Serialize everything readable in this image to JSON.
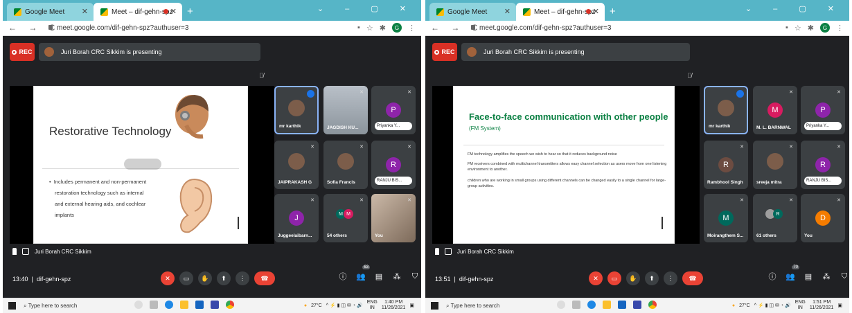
{
  "panes": [
    {
      "tabs": [
        "Google Meet",
        "Meet – dif-gehn-spz"
      ],
      "url": "meet.google.com/dif-gehn-spz?authuser=3",
      "rec_label": "REC",
      "presenting": "Juri Borah CRC Sikkim is presenting",
      "slide": {
        "title": "Restorative Technology",
        "bullets": [
          "Includes permanent and non-permanent restoration technology such as internal and external hearing aids, and cochlear implants"
        ]
      },
      "tiles": [
        {
          "name": "mr karthik",
          "kind": "photo",
          "selected": true
        },
        {
          "name": "JAGDISH KU...",
          "kind": "photo"
        },
        {
          "name": "Priyanka Y...",
          "letter": "P",
          "color": "#8e24aa",
          "pill": true
        },
        {
          "name": "JAIPRAKASH G",
          "kind": "photo"
        },
        {
          "name": "Sofia Francis",
          "kind": "photo"
        },
        {
          "name": "RANJU BIS...",
          "letter": "R",
          "color": "#8e24aa",
          "pill": true
        },
        {
          "name": "Juggeelaibarn...",
          "letter": "J",
          "color": "#8e24aa"
        },
        {
          "name": "54 others",
          "group": [
            "M",
            "M"
          ]
        },
        {
          "name": "You",
          "kind": "video"
        }
      ],
      "presenter_bar": "Juri Borah CRC Sikkim",
      "time": "13:40",
      "meeting_code": "dif-gehn-spz",
      "people_count": "63",
      "taskbar": {
        "search": "Type here to search",
        "temp": "27°C",
        "lang": "ENG",
        "region": "IN",
        "clock": "1:40 PM",
        "date": "11/26/2021"
      }
    },
    {
      "tabs": [
        "Google Meet",
        "Meet – dif-gehn-spz"
      ],
      "url": "meet.google.com/dif-gehn-spz?authuser=3",
      "rec_label": "REC",
      "presenting": "Juri Borah CRC Sikkim is presenting",
      "slide": {
        "title": "Face-to-face communication with other people",
        "subtitle": "(FM System)",
        "paragraphs": [
          "FM technology amplifies the speech we wish to hear so that it reduces background noise",
          "FM receivers combined with multichannel transmitters allows easy channel selection as users move from one listening environment to another.",
          "children who are working in small groups using different channels can be changed easily to a single channel for large-group activities."
        ]
      },
      "tiles": [
        {
          "name": "mr karthik",
          "kind": "photo",
          "selected": true
        },
        {
          "name": "M. L. BARNWAL",
          "letter": "M",
          "color": "#d81b60"
        },
        {
          "name": "Priyanka Y...",
          "letter": "P",
          "color": "#8e24aa",
          "pill": true
        },
        {
          "name": "Rambhool Singh",
          "letter": "R",
          "color": "#6d4c41"
        },
        {
          "name": "sreeja mitra",
          "kind": "photo"
        },
        {
          "name": "RANJU BIS...",
          "letter": "R",
          "color": "#8e24aa",
          "pill": true
        },
        {
          "name": "Moirangthem S...",
          "letter": "M",
          "color": "#00695c"
        },
        {
          "name": "61 others",
          "group": [
            "",
            "R"
          ]
        },
        {
          "name": "You",
          "letter": "D",
          "color": "#f57c00"
        }
      ],
      "presenter_bar": "Juri Borah CRC Sikkim",
      "time": "13:51",
      "meeting_code": "dif-gehn-spz",
      "people_count": "70",
      "taskbar": {
        "search": "Type here to search",
        "temp": "27°C",
        "lang": "ENG",
        "region": "IN",
        "clock": "1:51 PM",
        "date": "11/26/2021"
      }
    }
  ],
  "colors": {
    "meet_bg": "#202124",
    "tile_bg": "#3c4043",
    "rec_red": "#d93025",
    "tabbar": "#56b5c7",
    "fm_green": "#0b8043"
  }
}
